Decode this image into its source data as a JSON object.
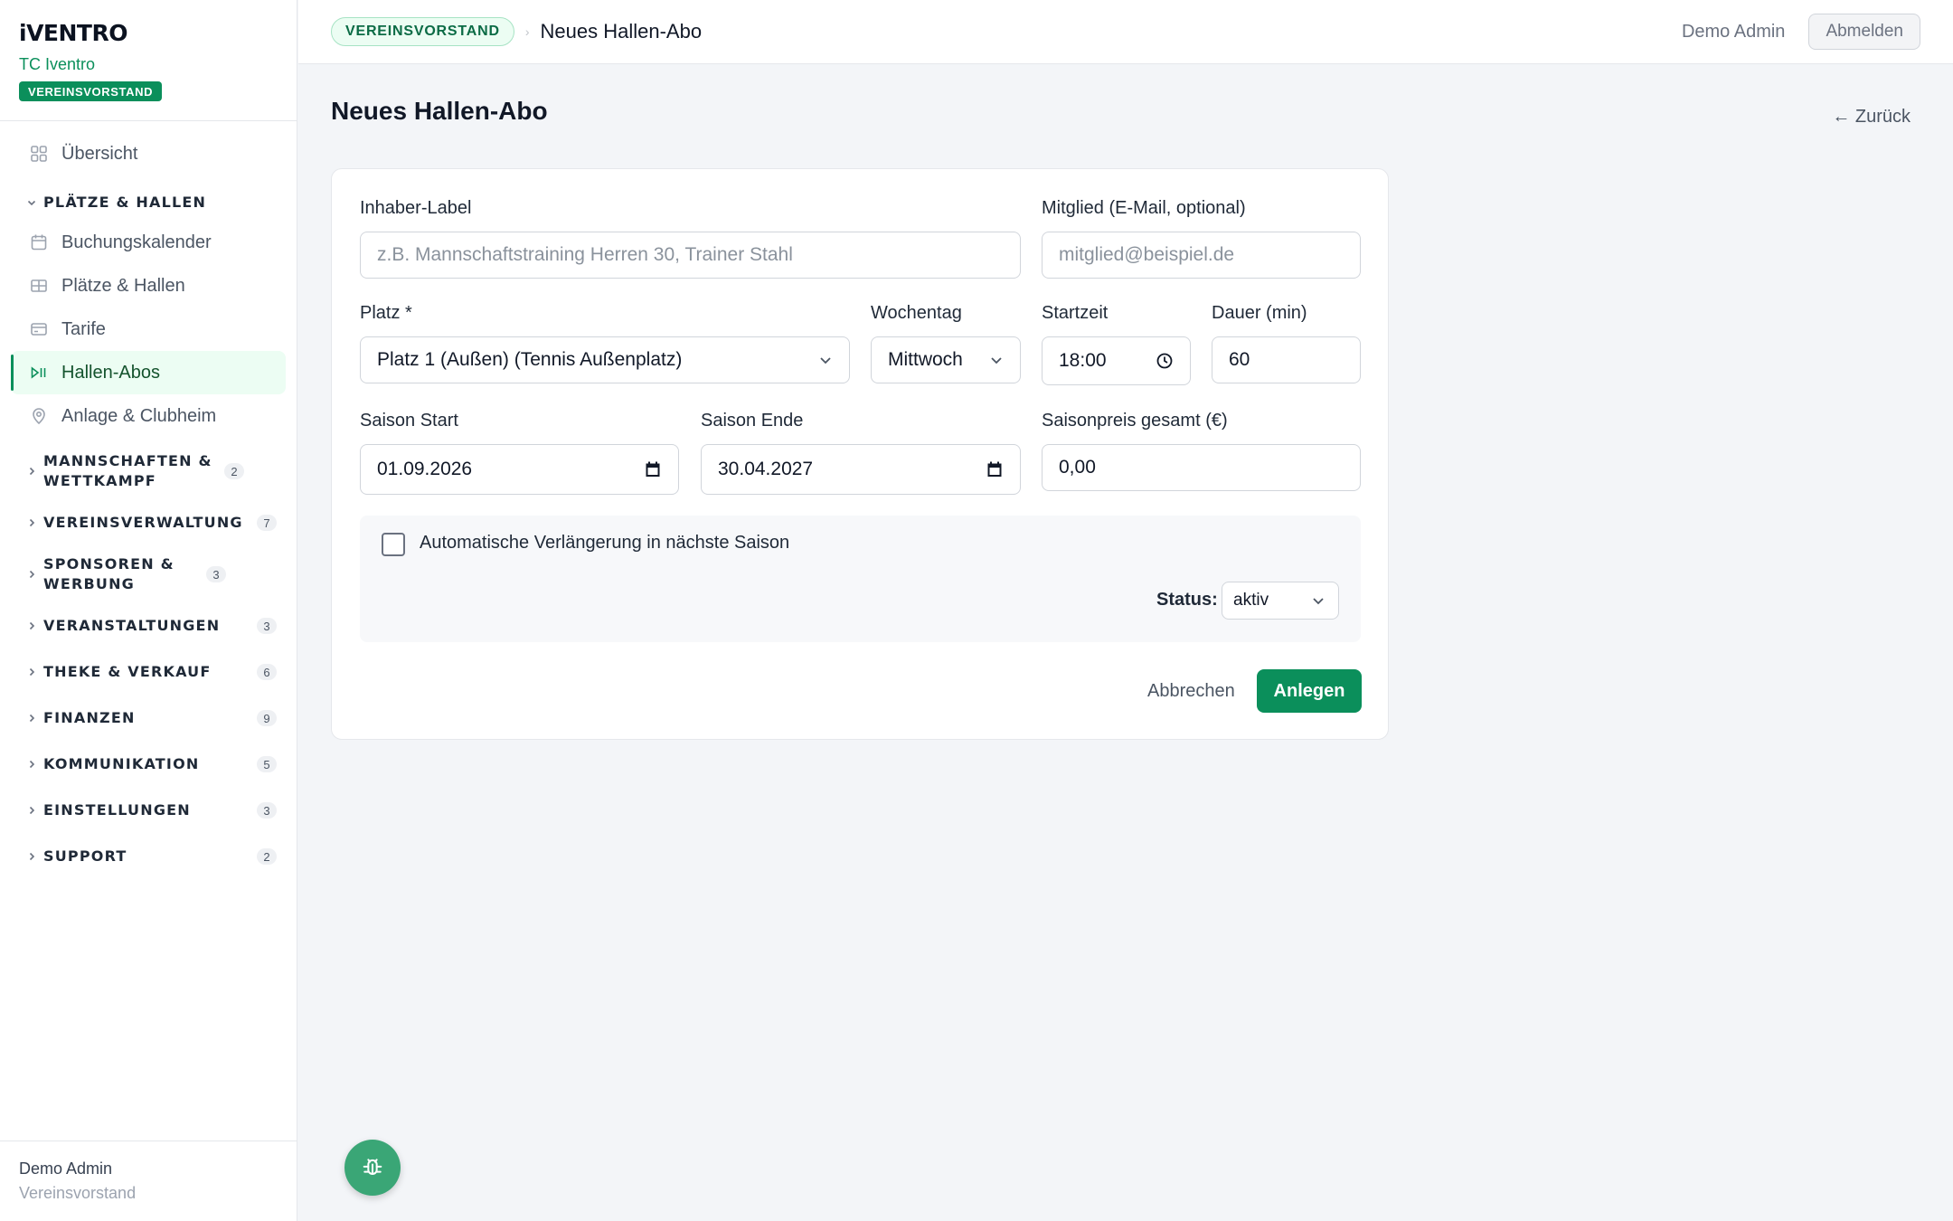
{
  "brand": {
    "logo": "iVENTRO",
    "club": "TC Iventro",
    "role_badge": "VEREINSVORSTAND"
  },
  "sidebar": {
    "overview": "Übersicht",
    "group_open": "PLÄTZE & HALLEN",
    "items": [
      {
        "label": "Buchungskalender",
        "icon": "calendar-icon"
      },
      {
        "label": "Plätze & Hallen",
        "icon": "table-grid-icon"
      },
      {
        "label": "Tarife",
        "icon": "credit-card-icon"
      },
      {
        "label": "Hallen-Abos",
        "icon": "play-pause-icon",
        "active": true
      },
      {
        "label": "Anlage & Clubheim",
        "icon": "map-pin-icon"
      }
    ],
    "groups": [
      {
        "label": "MANNSCHAFTEN & WETTKAMPF",
        "count": "2"
      },
      {
        "label": "VEREINSVERWALTUNG",
        "count": "7"
      },
      {
        "label": "SPONSOREN & WERBUNG",
        "count": "3"
      },
      {
        "label": "VERANSTALTUNGEN",
        "count": "3"
      },
      {
        "label": "THEKE & VERKAUF",
        "count": "6"
      },
      {
        "label": "FINANZEN",
        "count": "9"
      },
      {
        "label": "KOMMUNIKATION",
        "count": "5"
      },
      {
        "label": "EINSTELLUNGEN",
        "count": "3"
      },
      {
        "label": "SUPPORT",
        "count": "2"
      }
    ],
    "footer": {
      "user": "Demo Admin",
      "role": "Vereinsvorstand"
    }
  },
  "topbar": {
    "crumb_badge": "VEREINSVORSTAND",
    "crumb_sep": "›",
    "crumb_page": "Neues Hallen-Abo",
    "user": "Demo Admin",
    "logout": "Abmelden"
  },
  "main": {
    "title": "Neues Hallen-Abo",
    "back": "← Zurück"
  },
  "form": {
    "owner_label": "Inhaber-Label",
    "owner_placeholder": "z.B. Mannschaftstraining Herren 30, Trainer Stahl",
    "member_label": "Mitglied (E-Mail, optional)",
    "member_placeholder": "mitglied@beispiel.de",
    "court_label": "Platz *",
    "court_value": "Platz 1 (Außen) (Tennis Außenplatz)",
    "weekday_label": "Wochentag",
    "weekday_value": "Mittwoch",
    "start_label": "Startzeit",
    "start_value": "18:00",
    "duration_label": "Dauer (min)",
    "duration_value": "60",
    "season_start_label": "Saison Start",
    "season_start_value": "01.09.2026",
    "season_end_label": "Saison Ende",
    "season_end_value": "30.04.2027",
    "price_label": "Saisonpreis gesamt (€)",
    "price_value": "0,00",
    "auto_renew_label": "Automatische Verlängerung in nächste Saison",
    "auto_renew_checked": false,
    "status_label": "Status:",
    "status_value": "aktiv",
    "cancel": "Abbrechen",
    "submit": "Anlegen"
  },
  "colors": {
    "accent": "#0b8f5b",
    "fab": "#3aa676",
    "background": "#f3f5f8"
  }
}
